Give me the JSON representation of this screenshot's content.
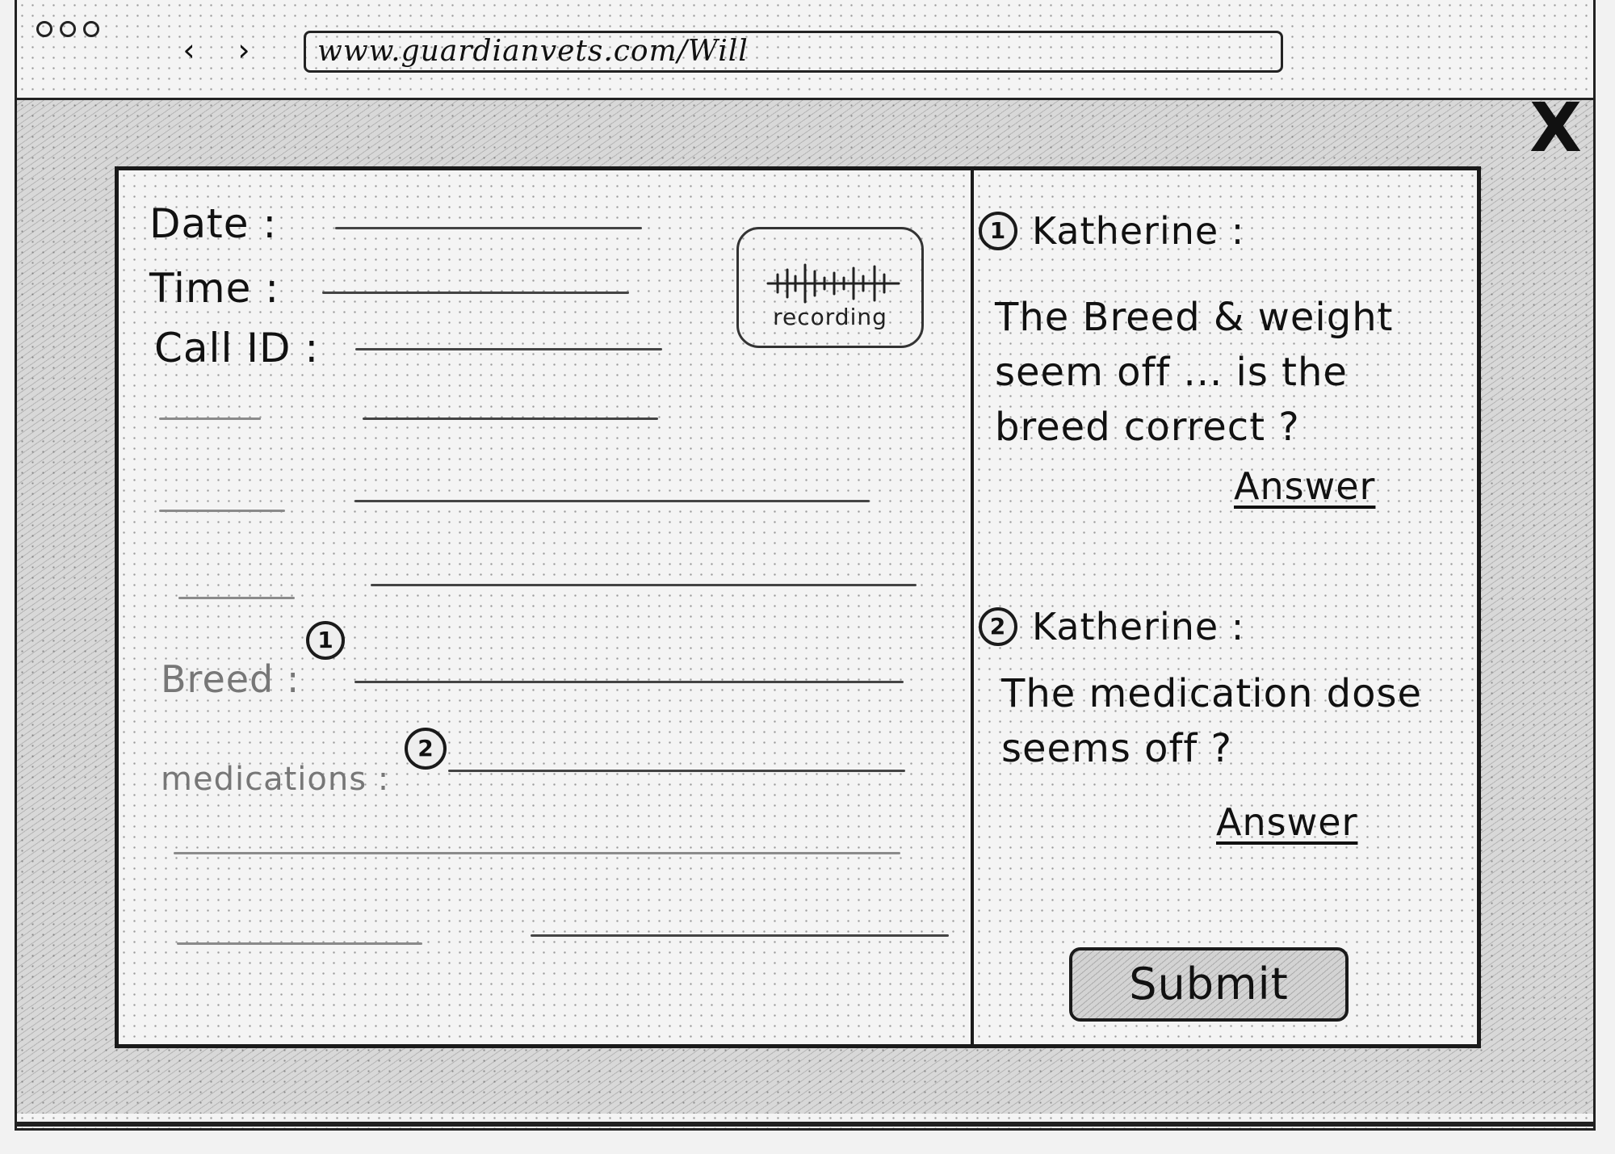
{
  "browser": {
    "url": "www.guardianvets.com/Will",
    "back_label": "‹",
    "forward_label": "›"
  },
  "modal": {
    "close_label": "X",
    "form": {
      "date_label": "Date :",
      "time_label": "Time :",
      "call_id_label": "Call ID :",
      "breed_label": "Breed :",
      "medications_label": "medications :",
      "recording_label": "recording",
      "breed_marker": "1",
      "medications_marker": "2"
    },
    "comments": [
      {
        "number": "1",
        "author": "Katherine :",
        "text": "The Breed & weight seem off ... is the breed correct ?",
        "action": "Answer"
      },
      {
        "number": "2",
        "author": "Katherine :",
        "text": "The medication dose seems off ?",
        "action": "Answer"
      }
    ],
    "submit_label": "Submit"
  }
}
